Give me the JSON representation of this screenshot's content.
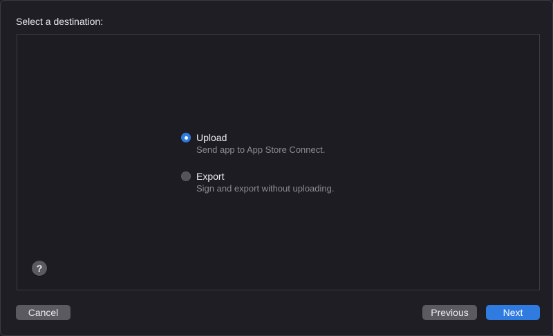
{
  "dialog": {
    "heading": "Select a destination:"
  },
  "options": [
    {
      "title": "Upload",
      "subtitle": "Send app to App Store Connect.",
      "selected": true
    },
    {
      "title": "Export",
      "subtitle": "Sign and export without uploading.",
      "selected": false
    }
  ],
  "help": {
    "label": "?"
  },
  "footer": {
    "cancel_label": "Cancel",
    "previous_label": "Previous",
    "next_label": "Next"
  },
  "colors": {
    "accent": "#2f7be0",
    "background": "#1f1e24",
    "button_gray": "#5b5a61"
  }
}
